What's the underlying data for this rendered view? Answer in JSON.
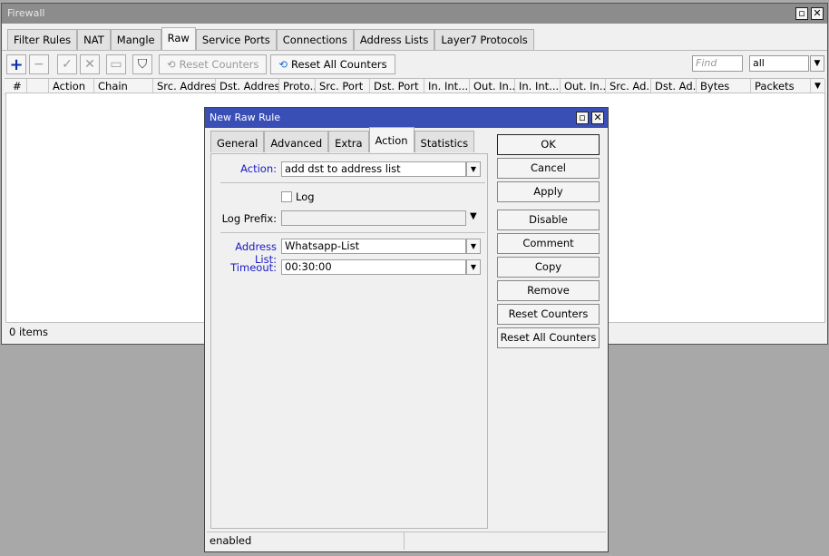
{
  "window": {
    "title": "Firewall"
  },
  "tabs": [
    "Filter Rules",
    "NAT",
    "Mangle",
    "Raw",
    "Service Ports",
    "Connections",
    "Address Lists",
    "Layer7 Protocols"
  ],
  "active_tab": "Raw",
  "toolbar": {
    "reset_counters": "Reset Counters",
    "reset_all_counters": "Reset All Counters",
    "find_placeholder": "Find",
    "filter_value": "all"
  },
  "columns": [
    "#",
    "",
    "Action",
    "Chain",
    "Src. Address",
    "Dst. Address",
    "Proto...",
    "Src. Port",
    "Dst. Port",
    "In. Int...",
    "Out. In...",
    "In. Int...",
    "Out. In...",
    "Src. Ad...",
    "Dst. Ad...",
    "Bytes",
    "Packets"
  ],
  "status": {
    "items": "0 items"
  },
  "dialog": {
    "title": "New Raw Rule",
    "tabs": [
      "General",
      "Advanced",
      "Extra",
      "Action",
      "Statistics"
    ],
    "active_tab": "Action",
    "action_label": "Action:",
    "action_value": "add dst to address list",
    "log_label": "Log",
    "log_prefix_label": "Log Prefix:",
    "log_prefix_value": "",
    "address_list_label": "Address List:",
    "address_list_value": "Whatsapp-List",
    "timeout_label": "Timeout:",
    "timeout_value": "00:30:00",
    "buttons": {
      "ok": "OK",
      "cancel": "Cancel",
      "apply": "Apply",
      "disable": "Disable",
      "comment": "Comment",
      "copy": "Copy",
      "remove": "Remove",
      "reset_counters": "Reset Counters",
      "reset_all_counters": "Reset All Counters"
    },
    "status": "enabled"
  }
}
